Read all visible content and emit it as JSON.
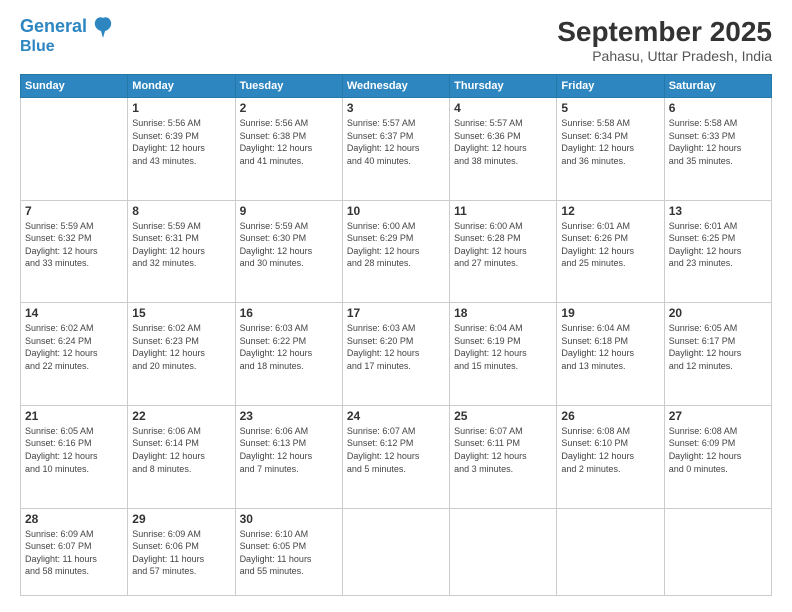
{
  "header": {
    "logo_line1": "General",
    "logo_line2": "Blue",
    "month": "September 2025",
    "location": "Pahasu, Uttar Pradesh, India"
  },
  "weekdays": [
    "Sunday",
    "Monday",
    "Tuesday",
    "Wednesday",
    "Thursday",
    "Friday",
    "Saturday"
  ],
  "weeks": [
    [
      {
        "day": "",
        "info": ""
      },
      {
        "day": "1",
        "info": "Sunrise: 5:56 AM\nSunset: 6:39 PM\nDaylight: 12 hours\nand 43 minutes."
      },
      {
        "day": "2",
        "info": "Sunrise: 5:56 AM\nSunset: 6:38 PM\nDaylight: 12 hours\nand 41 minutes."
      },
      {
        "day": "3",
        "info": "Sunrise: 5:57 AM\nSunset: 6:37 PM\nDaylight: 12 hours\nand 40 minutes."
      },
      {
        "day": "4",
        "info": "Sunrise: 5:57 AM\nSunset: 6:36 PM\nDaylight: 12 hours\nand 38 minutes."
      },
      {
        "day": "5",
        "info": "Sunrise: 5:58 AM\nSunset: 6:34 PM\nDaylight: 12 hours\nand 36 minutes."
      },
      {
        "day": "6",
        "info": "Sunrise: 5:58 AM\nSunset: 6:33 PM\nDaylight: 12 hours\nand 35 minutes."
      }
    ],
    [
      {
        "day": "7",
        "info": "Sunrise: 5:59 AM\nSunset: 6:32 PM\nDaylight: 12 hours\nand 33 minutes."
      },
      {
        "day": "8",
        "info": "Sunrise: 5:59 AM\nSunset: 6:31 PM\nDaylight: 12 hours\nand 32 minutes."
      },
      {
        "day": "9",
        "info": "Sunrise: 5:59 AM\nSunset: 6:30 PM\nDaylight: 12 hours\nand 30 minutes."
      },
      {
        "day": "10",
        "info": "Sunrise: 6:00 AM\nSunset: 6:29 PM\nDaylight: 12 hours\nand 28 minutes."
      },
      {
        "day": "11",
        "info": "Sunrise: 6:00 AM\nSunset: 6:28 PM\nDaylight: 12 hours\nand 27 minutes."
      },
      {
        "day": "12",
        "info": "Sunrise: 6:01 AM\nSunset: 6:26 PM\nDaylight: 12 hours\nand 25 minutes."
      },
      {
        "day": "13",
        "info": "Sunrise: 6:01 AM\nSunset: 6:25 PM\nDaylight: 12 hours\nand 23 minutes."
      }
    ],
    [
      {
        "day": "14",
        "info": "Sunrise: 6:02 AM\nSunset: 6:24 PM\nDaylight: 12 hours\nand 22 minutes."
      },
      {
        "day": "15",
        "info": "Sunrise: 6:02 AM\nSunset: 6:23 PM\nDaylight: 12 hours\nand 20 minutes."
      },
      {
        "day": "16",
        "info": "Sunrise: 6:03 AM\nSunset: 6:22 PM\nDaylight: 12 hours\nand 18 minutes."
      },
      {
        "day": "17",
        "info": "Sunrise: 6:03 AM\nSunset: 6:20 PM\nDaylight: 12 hours\nand 17 minutes."
      },
      {
        "day": "18",
        "info": "Sunrise: 6:04 AM\nSunset: 6:19 PM\nDaylight: 12 hours\nand 15 minutes."
      },
      {
        "day": "19",
        "info": "Sunrise: 6:04 AM\nSunset: 6:18 PM\nDaylight: 12 hours\nand 13 minutes."
      },
      {
        "day": "20",
        "info": "Sunrise: 6:05 AM\nSunset: 6:17 PM\nDaylight: 12 hours\nand 12 minutes."
      }
    ],
    [
      {
        "day": "21",
        "info": "Sunrise: 6:05 AM\nSunset: 6:16 PM\nDaylight: 12 hours\nand 10 minutes."
      },
      {
        "day": "22",
        "info": "Sunrise: 6:06 AM\nSunset: 6:14 PM\nDaylight: 12 hours\nand 8 minutes."
      },
      {
        "day": "23",
        "info": "Sunrise: 6:06 AM\nSunset: 6:13 PM\nDaylight: 12 hours\nand 7 minutes."
      },
      {
        "day": "24",
        "info": "Sunrise: 6:07 AM\nSunset: 6:12 PM\nDaylight: 12 hours\nand 5 minutes."
      },
      {
        "day": "25",
        "info": "Sunrise: 6:07 AM\nSunset: 6:11 PM\nDaylight: 12 hours\nand 3 minutes."
      },
      {
        "day": "26",
        "info": "Sunrise: 6:08 AM\nSunset: 6:10 PM\nDaylight: 12 hours\nand 2 minutes."
      },
      {
        "day": "27",
        "info": "Sunrise: 6:08 AM\nSunset: 6:09 PM\nDaylight: 12 hours\nand 0 minutes."
      }
    ],
    [
      {
        "day": "28",
        "info": "Sunrise: 6:09 AM\nSunset: 6:07 PM\nDaylight: 11 hours\nand 58 minutes."
      },
      {
        "day": "29",
        "info": "Sunrise: 6:09 AM\nSunset: 6:06 PM\nDaylight: 11 hours\nand 57 minutes."
      },
      {
        "day": "30",
        "info": "Sunrise: 6:10 AM\nSunset: 6:05 PM\nDaylight: 11 hours\nand 55 minutes."
      },
      {
        "day": "",
        "info": ""
      },
      {
        "day": "",
        "info": ""
      },
      {
        "day": "",
        "info": ""
      },
      {
        "day": "",
        "info": ""
      }
    ]
  ]
}
